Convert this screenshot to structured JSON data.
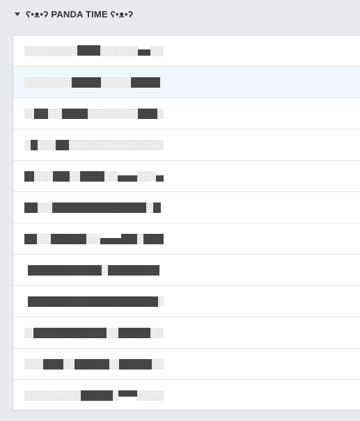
{
  "group": {
    "title": "ʕ•ᴥ•ʔ PANDA TIME ʕ•ᴥ•ʔ",
    "expanded": true,
    "caret_icon": "caret-down-icon"
  },
  "list": {
    "selected_index": 1,
    "items": [
      {
        "redacted": true
      },
      {
        "redacted": true
      },
      {
        "redacted": true
      },
      {
        "redacted": true
      },
      {
        "redacted": true
      },
      {
        "redacted": true
      },
      {
        "redacted": true
      },
      {
        "redacted": true
      },
      {
        "redacted": true
      },
      {
        "redacted": true
      },
      {
        "redacted": true
      },
      {
        "redacted": true
      }
    ]
  }
}
